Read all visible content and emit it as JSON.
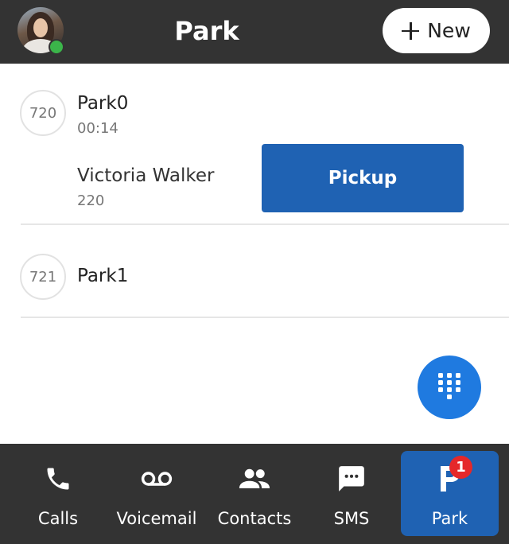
{
  "header": {
    "title": "Park",
    "new_label": "New"
  },
  "parks": [
    {
      "ext": "720",
      "name": "Park0",
      "time": "00:14",
      "caller_name": "Victoria Walker",
      "caller_ext": "220",
      "pickup_label": "Pickup"
    },
    {
      "ext": "721",
      "name": "Park1"
    }
  ],
  "nav": {
    "items": [
      {
        "label": "Calls",
        "icon": "phone-icon"
      },
      {
        "label": "Voicemail",
        "icon": "voicemail-icon"
      },
      {
        "label": "Contacts",
        "icon": "contacts-icon"
      },
      {
        "label": "SMS",
        "icon": "sms-icon"
      },
      {
        "label": "Park",
        "icon": "park-icon",
        "active": true,
        "badge": "1"
      }
    ]
  },
  "colors": {
    "header_bg": "#333333",
    "accent_blue": "#1f62b3",
    "fab_blue": "#1f7ae0",
    "presence_green": "#3bb54a",
    "badge_red": "#e5282a"
  }
}
